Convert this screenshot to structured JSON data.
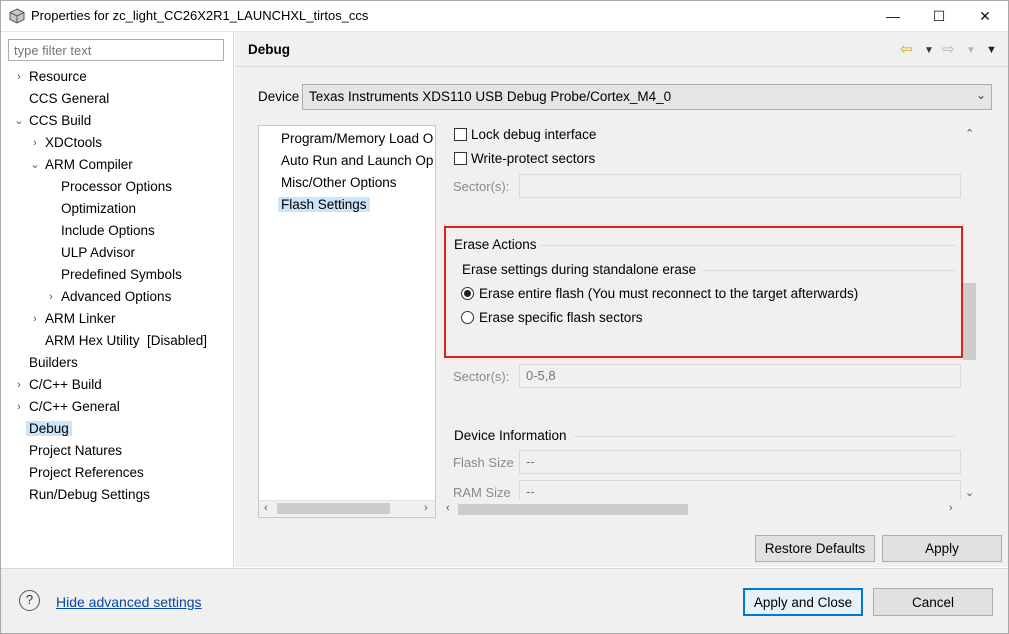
{
  "window": {
    "title": "Properties for zc_light_CC26X2R1_LAUNCHXL_tirtos_ccs",
    "minimize": "—",
    "maximize": "☐",
    "close": "✕"
  },
  "filter": {
    "placeholder": "type filter text"
  },
  "tree": [
    {
      "label": "Resource"
    },
    {
      "label": "CCS General"
    },
    {
      "label": "CCS Build"
    },
    {
      "label": "XDCtools"
    },
    {
      "label": "ARM Compiler"
    },
    {
      "label": "Processor Options"
    },
    {
      "label": "Optimization"
    },
    {
      "label": "Include Options"
    },
    {
      "label": "ULP Advisor"
    },
    {
      "label": "Predefined Symbols"
    },
    {
      "label": "Advanced Options"
    },
    {
      "label": "ARM Linker"
    },
    {
      "label": "ARM Hex Utility  [Disabled]"
    },
    {
      "label": "Builders"
    },
    {
      "label": "C/C++ Build"
    },
    {
      "label": "C/C++ General"
    },
    {
      "label": "Debug"
    },
    {
      "label": "Project Natures"
    },
    {
      "label": "Project References"
    },
    {
      "label": "Run/Debug Settings"
    }
  ],
  "main": {
    "title": "Debug",
    "device_label": "Device",
    "device_value": "Texas Instruments XDS110 USB Debug Probe/Cortex_M4_0"
  },
  "categories": [
    {
      "label": "Program/Memory Load O"
    },
    {
      "label": "Auto Run and Launch Op"
    },
    {
      "label": "Misc/Other Options"
    },
    {
      "label": "Flash Settings"
    }
  ],
  "settings": {
    "lock_debug": "Lock debug interface",
    "write_protect": "Write-protect sectors",
    "sectors_label": "Sector(s):",
    "sectors_value_top": "",
    "erase_actions": "Erase Actions",
    "erase_group": "Erase settings during standalone erase",
    "erase_entire": "Erase entire flash (You must reconnect to the target afterwards)",
    "erase_specific": "Erase specific flash sectors",
    "sectors_value_mid": "0-5,8",
    "device_info": "Device Information",
    "flash_size_label": "Flash Size",
    "flash_size_value": "--",
    "ram_size_label": "RAM Size",
    "ram_size_value": "--"
  },
  "buttons": {
    "restore_defaults": "Restore Defaults",
    "apply": "Apply",
    "apply_close": "Apply and Close",
    "cancel": "Cancel"
  },
  "footer": {
    "help_glyph": "?",
    "advanced_link": "Hide advanced settings"
  },
  "colors": {
    "accent": "#0078d7",
    "highlight": "#e02020",
    "selection": "#cce4f7"
  }
}
